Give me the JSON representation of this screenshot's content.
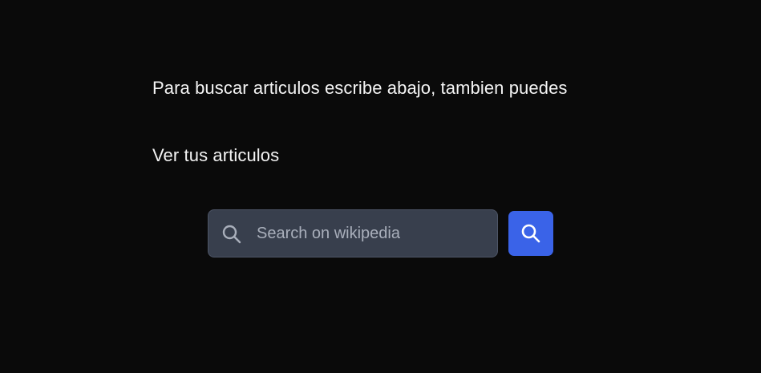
{
  "intro": {
    "line1": "Para buscar articulos escribe abajo, tambien puedes",
    "line2": "Ver tus articulos"
  },
  "search": {
    "placeholder": "Search on wikipedia",
    "value": "",
    "input_icon": "search-icon",
    "button_icon": "search-icon"
  },
  "colors": {
    "background": "#0a0a0a",
    "input_background": "#383f4d",
    "button_accent": "#3a63e8",
    "text": "#f4f4f4",
    "placeholder": "#a9afbb"
  }
}
